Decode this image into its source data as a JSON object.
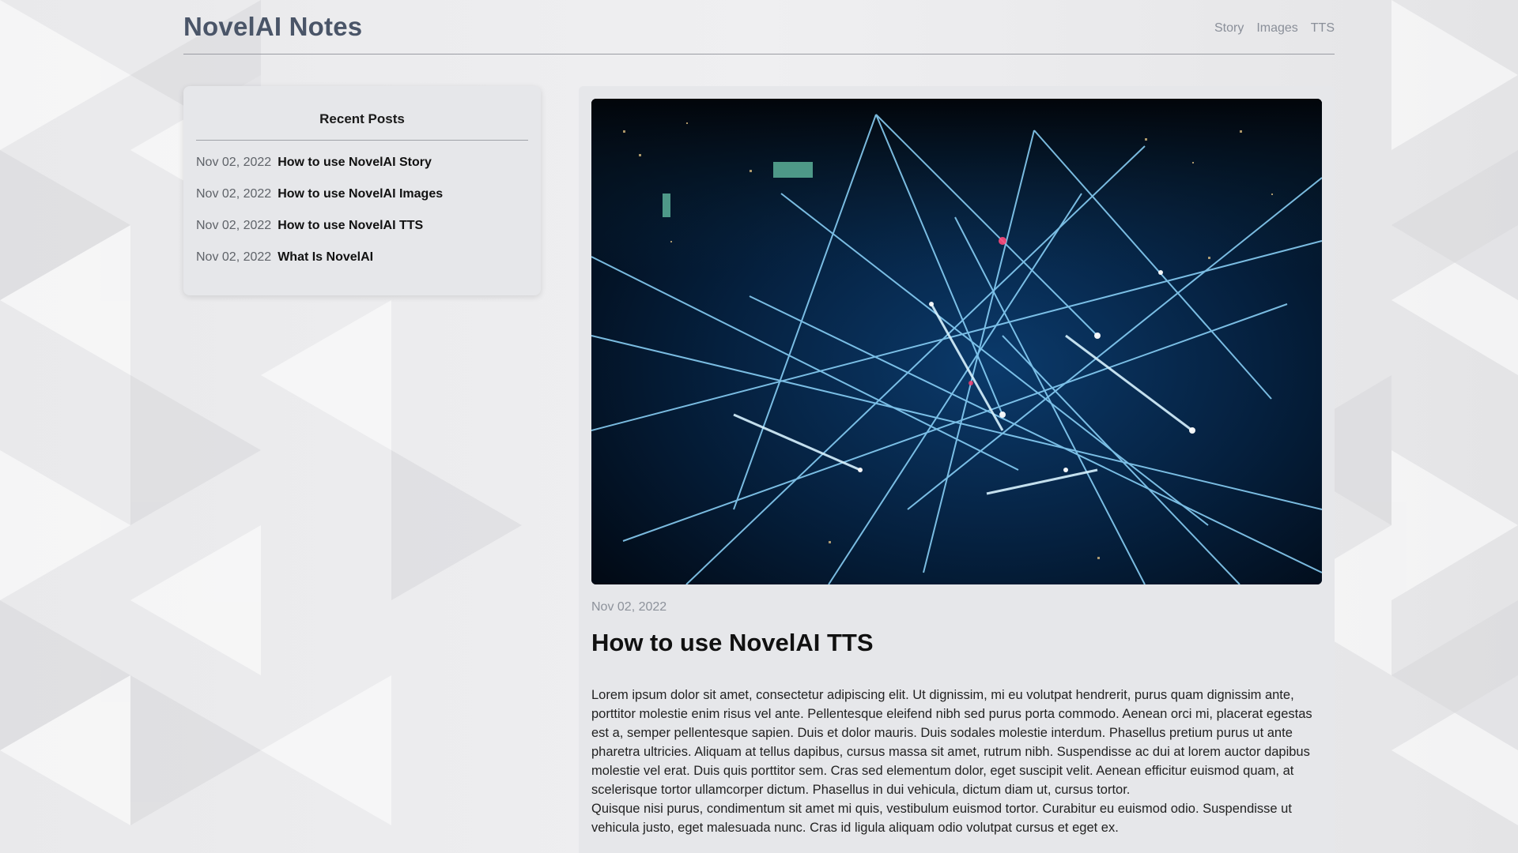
{
  "site": {
    "title": "NovelAI Notes"
  },
  "nav": {
    "items": [
      {
        "label": "Story"
      },
      {
        "label": "Images"
      },
      {
        "label": "TTS"
      }
    ]
  },
  "sidebar": {
    "title": "Recent Posts",
    "posts": [
      {
        "date": "Nov 02, 2022",
        "title": "How to use NovelAI Story"
      },
      {
        "date": "Nov 02, 2022",
        "title": "How to use NovelAI Images"
      },
      {
        "date": "Nov 02, 2022",
        "title": "How to use NovelAI TTS"
      },
      {
        "date": "Nov 02, 2022",
        "title": "What Is NovelAI"
      }
    ]
  },
  "article": {
    "date": "Nov 02, 2022",
    "title": "How to use NovelAI TTS",
    "paragraphs": [
      "Lorem ipsum dolor sit amet, consectetur adipiscing elit. Ut dignissim, mi eu volutpat hendrerit, purus quam dignissim ante, porttitor molestie enim risus vel ante. Pellentesque eleifend nibh sed purus porta commodo. Aenean orci mi, placerat egestas est a, semper pellentesque sapien. Duis et dolor mauris. Duis sodales molestie interdum. Phasellus pretium purus ut ante pharetra ultricies. Aliquam at tellus dapibus, cursus massa sit amet, rutrum nibh. Suspendisse ac dui at lorem auctor dapibus molestie vel erat. Duis quis porttitor sem. Cras sed elementum dolor, eget suscipit velit. Aenean efficitur euismod quam, at scelerisque tortor ullamcorper dictum. Phasellus in dui vehicula, dictum diam ut, cursus tortor.",
      "Quisque nisi purus, condimentum sit amet mi quis, vestibulum euismod tortor. Curabitur eu euismod odio. Suspendisse ut vehicula justo, eget malesuada nunc. Cras id ligula aliquam odio volutpat cursus et eget ex."
    ]
  },
  "colors": {
    "accent_title": "#4a5568",
    "panel_bg": "#e6e7ea",
    "page_bg": "#ececee",
    "muted_text": "#8a8f99"
  }
}
